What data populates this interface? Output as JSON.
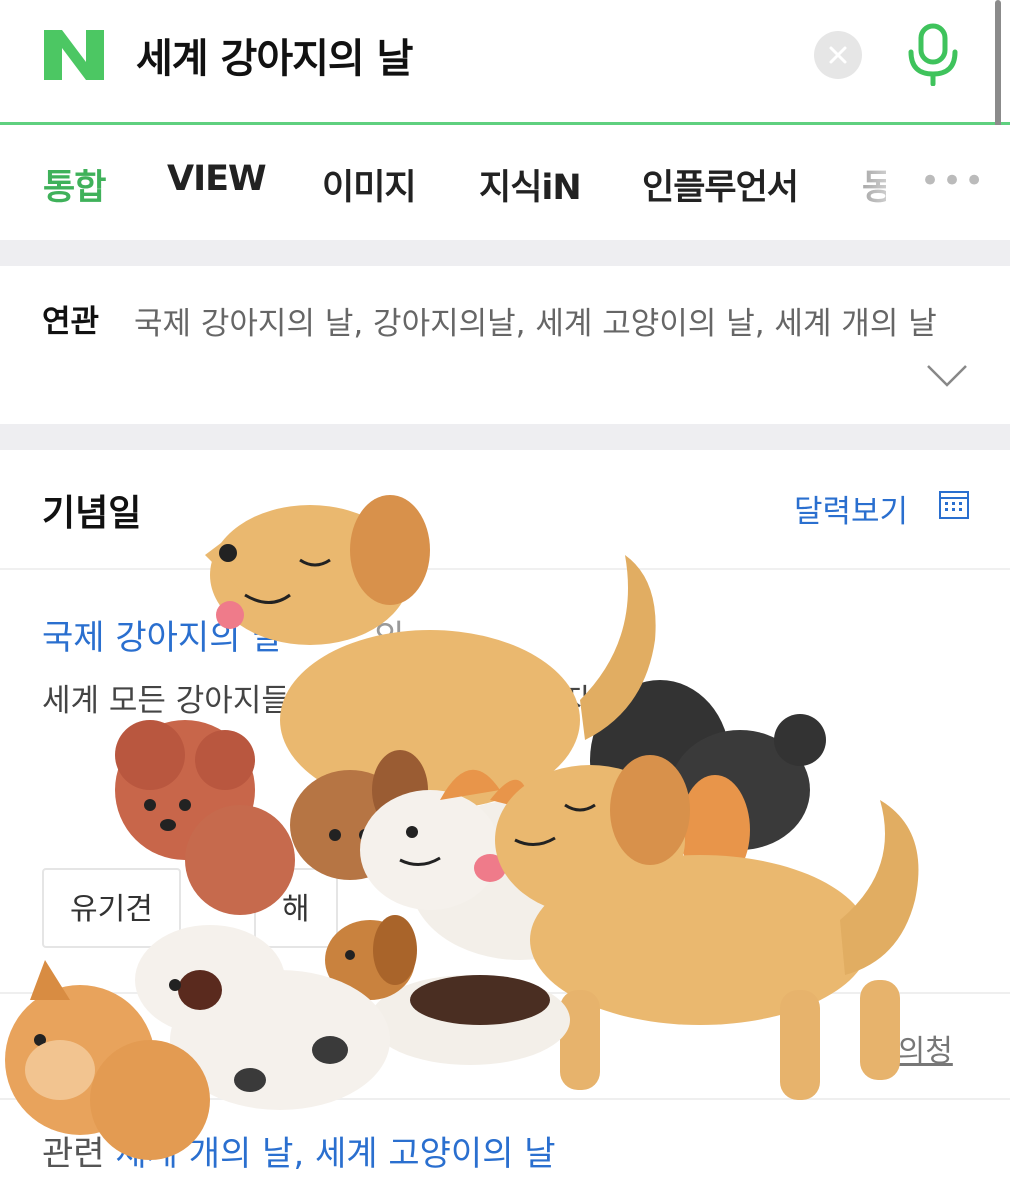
{
  "search": {
    "query": "세계 강아지의 날"
  },
  "tabs": [
    {
      "label": "통합",
      "active": true
    },
    {
      "label": "VIEW"
    },
    {
      "label": "이미지"
    },
    {
      "label": "지식iN"
    },
    {
      "label": "인플루언서"
    },
    {
      "label": "동"
    }
  ],
  "related": {
    "label": "연관",
    "text": "국제 강아지의 날, 강아지의날, 세계 고양이의 날, 세계 개의 날"
  },
  "anniversary": {
    "section_title": "기념일",
    "calendar_link": "달력보기",
    "event_title": "국제 강아지의 날",
    "event_suffix": "의",
    "description": "세계 모든 강아지들 ... 것 은 ... 입양 ... 지 로 제...",
    "chips": [
      "유기견",
      "해"
    ],
    "source": "정의청",
    "related_prefix": "관련",
    "related_links": "세계 개의 날, 세계 고양이의 날"
  },
  "colors": {
    "brand_green": "#3fb15a",
    "link_blue": "#2a6fcf"
  }
}
